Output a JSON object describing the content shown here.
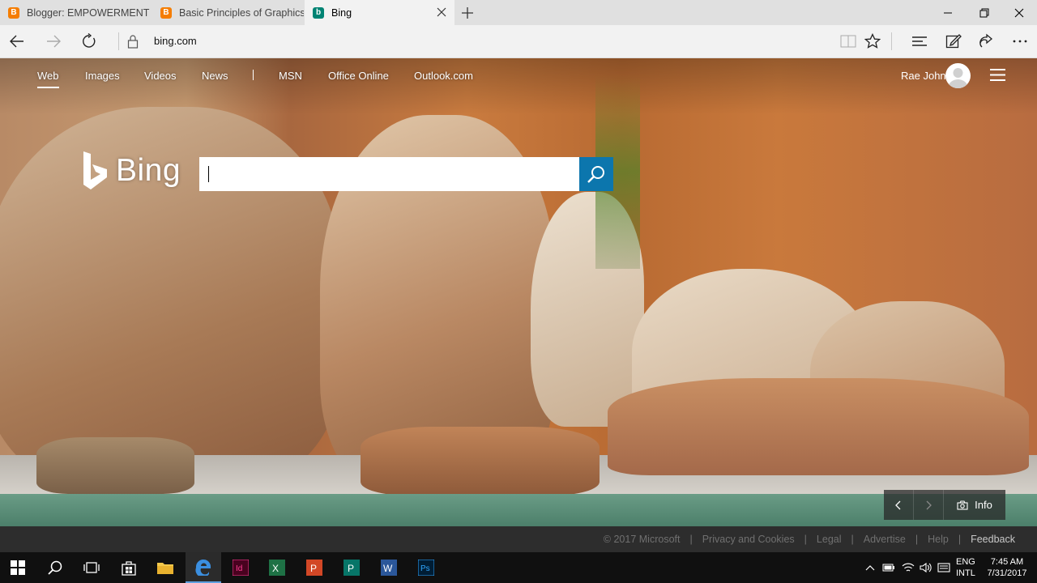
{
  "browser": {
    "tabs": [
      {
        "label": "Blogger: EMPOWERMENT T",
        "icon": "blogger-icon"
      },
      {
        "label": "Basic Principles of Graphics",
        "icon": "blogger-icon"
      },
      {
        "label": "Bing",
        "icon": "bing-icon"
      }
    ],
    "address": "bing.com"
  },
  "bing": {
    "nav": {
      "web": "Web",
      "images": "Images",
      "videos": "Videos",
      "news": "News",
      "msn": "MSN",
      "office": "Office Online",
      "outlook": "Outlook.com"
    },
    "user_name": "Rae John",
    "logo_text": "Bing",
    "search_value": "",
    "info_label": "Info",
    "accent": "#0c76ad"
  },
  "footer": {
    "copyright": "© 2017 Microsoft",
    "privacy": "Privacy and Cookies",
    "legal": "Legal",
    "advertise": "Advertise",
    "help": "Help",
    "feedback": "Feedback"
  },
  "taskbar": {
    "lang_top": "ENG",
    "lang_bottom": "INTL",
    "time": "7:45 AM",
    "date": "7/31/2017"
  }
}
